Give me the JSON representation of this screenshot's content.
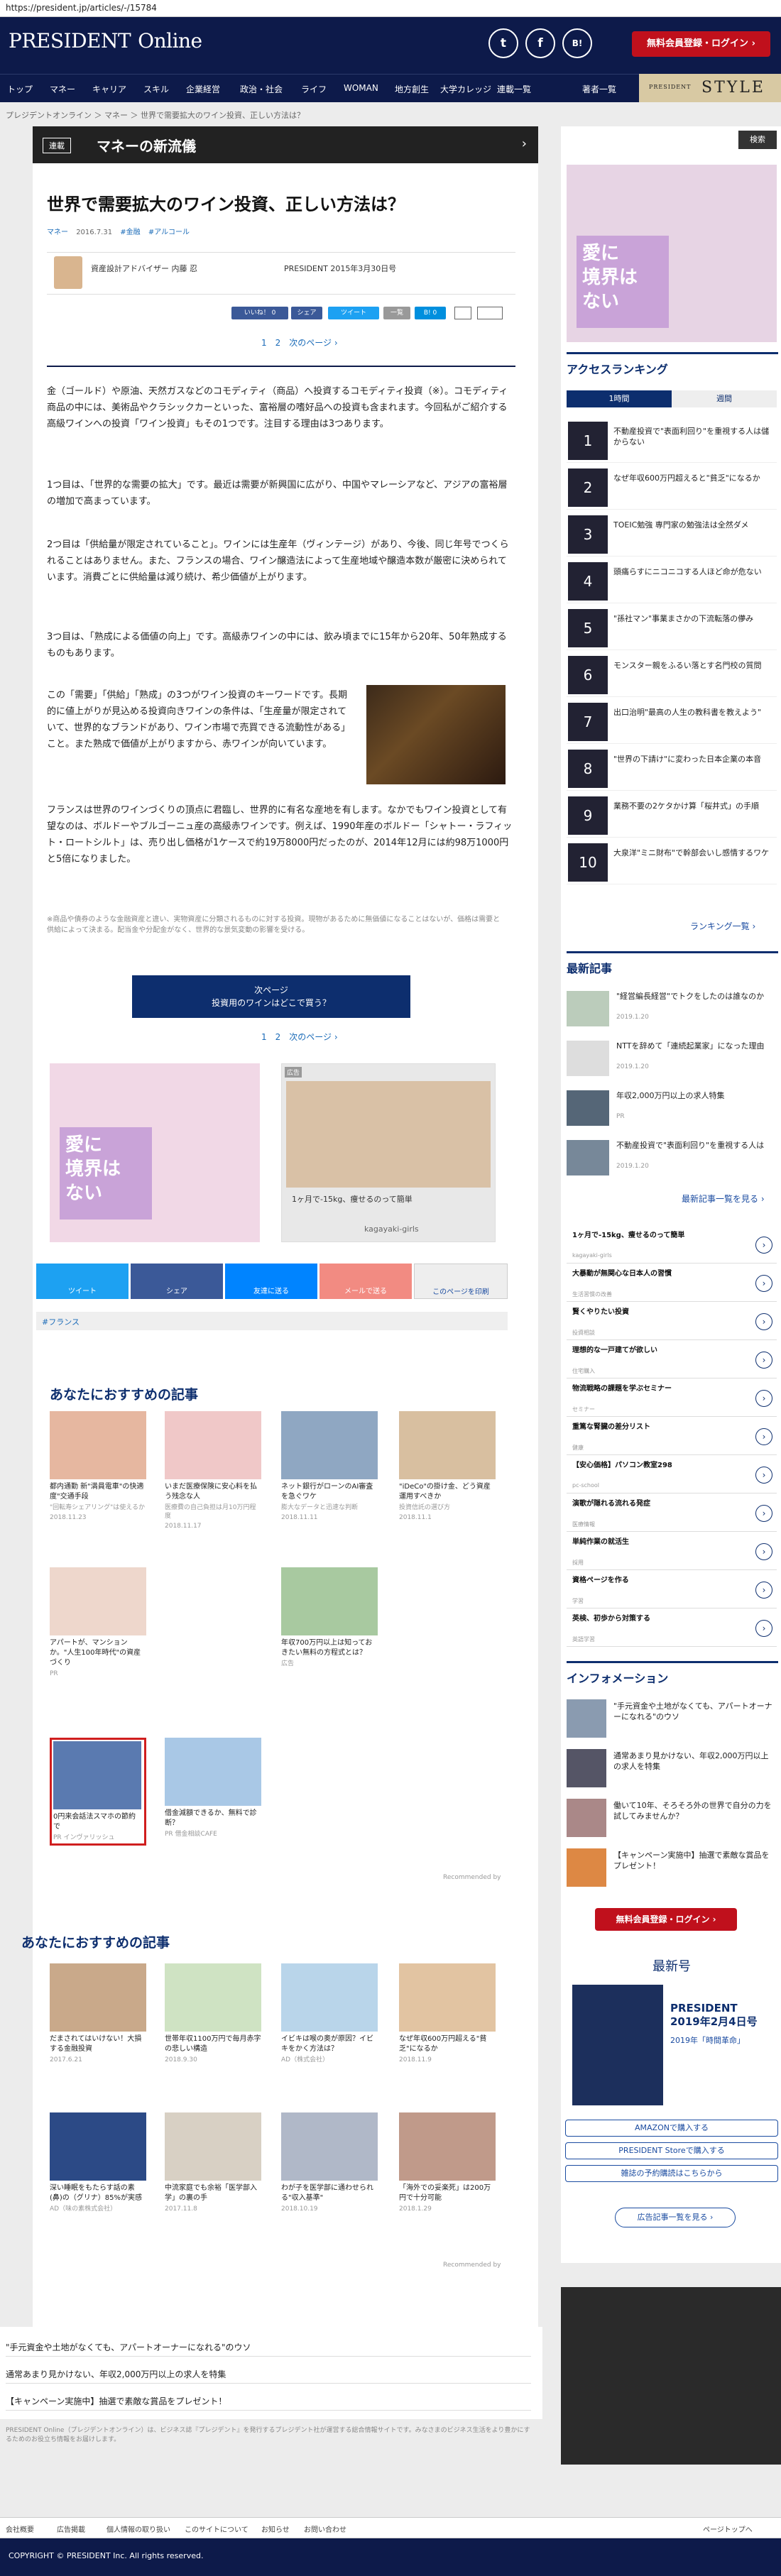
{
  "browser": {
    "url": "https://president.jp/articles/-/15784"
  },
  "header": {
    "logo_a": "PRESIDENT",
    "logo_b": "Online",
    "social": [
      "t",
      "f",
      "B!"
    ],
    "register": "無料会員登録・ログイン ›"
  },
  "nav": {
    "items": [
      "トップ",
      "マネー",
      "キャリア",
      "スキル",
      "企業経営",
      "政治・社会",
      "ライフ",
      "WOMAN",
      "地方創生",
      "大学カレッジ",
      "連載一覧",
      "著者一覧"
    ],
    "style_small": "PRESIDENT",
    "style": "STYLE"
  },
  "breadcrumb": "プレジデントオンライン ＞ マネー ＞ 世界で需要拡大のワイン投資、正しい方法は？",
  "band": {
    "tag": "連載",
    "title": "マネーの新流儀"
  },
  "article": {
    "title": "世界で需要拡大のワイン投資、正しい方法は？",
    "meta": [
      "マネー",
      "2016.7.31",
      "#金融",
      "#アルコール"
    ],
    "author": "資産設計アドバイザー 内藤 忍",
    "date": "PRESIDENT 2015年3月30日号",
    "share": [
      "いいね！ 0",
      "シェア",
      "ツイート",
      "一覧",
      "B! 0"
    ],
    "pager": "1　2　次のページ ›",
    "p1": "金（ゴールド）や原油、天然ガスなどのコモディティ（商品）へ投資するコモディティ投資（※）。コモディティ商品の中には、美術品やクラシックカーといった、富裕層の嗜好品への投資も含まれます。今回私がご紹介する高級ワインへの投資「ワイン投資」もその1つです。注目する理由は3つあります。",
    "p2": "1つ目は、「世界的な需要の拡大」です。最近は需要が新興国に広がり、中国やマレーシアなど、アジアの富裕層の増加で高まっています。",
    "p3": "2つ目は「供給量が限定されていること」。ワインには生産年（ヴィンテージ）があり、今後、同じ年号でつくられることはありません。また、フランスの場合、ワイン醸造法によって生産地域や醸造本数が厳密に決められています。消費ごとに供給量は減り続け、希少価値が上がります。",
    "p4": "3つ目は、「熟成による価値の向上」です。高級赤ワインの中には、飲み頃までに15年から20年、50年熟成するものもあります。",
    "p5": "この「需要」「供給」「熟成」の3つがワイン投資のキーワードです。長期的に値上がりが見込める投資向きワインの条件は、「生産量が限定されていて、世界的なブランドがあり、ワイン市場で売買できる流動性がある」こと。また熟成で価値が上がりますから、赤ワインが向いています。",
    "p6": "フランスは世界のワインづくりの頂点に君臨し、世界的に有名な産地を有します。なかでもワイン投資として有望なのは、ボルドーやブルゴーニュ産の高級赤ワインです。例えば、1990年産のボルドー「シャトー・ラフィット・ロートシルト」は、売り出し価格が1ケースで約19万8000円だったのが、2014年12月には約98万1000円と5倍になりました。",
    "note": "※商品や債券のような金融資産と違い、実物資産に分類されるものに対する投資。現物があるために無価値になることはないが、価格は需要と供給によって決まる。配当金や分配金がなく、世界的な景気変動の影響を受ける。",
    "next_l1": "次ページ",
    "next_l2": "投資用のワインはどこで買う？",
    "pager2": "1　2　次のページ ›"
  },
  "ads": {
    "left": "愛に\n境界は\nない",
    "right_label": "広告",
    "right_text": "1ヶ月で-15kg、痩せるのって簡単",
    "right_url": "kagayaki-girls"
  },
  "sharebar": [
    "ツイート",
    "シェア",
    "友達に送る",
    "メールで送る",
    "このページを印刷"
  ],
  "tags": "#フランス",
  "rec1": {
    "title": "あなたにおすすめの記事",
    "cards": [
      {
        "t": "都内通勤 新\"満員電車\"の快適度\"交通手段",
        "s": "\"回転寿シェアリング\"は使えるか",
        "d": "2018.11.23"
      },
      {
        "t": "いまだ医療保険に安心料を払う残念な人",
        "s": "医療費の自己負担は月10万円程度",
        "d": "2018.11.17"
      },
      {
        "t": "ネット銀行がローンのAI審査を急ぐワケ",
        "s": "膨大なデータと迅速な判断",
        "d": "2018.11.11"
      },
      {
        "t": "\"iDeCo\"の掛け金、どう資産運用すべきか",
        "s": "投資信託の選び方",
        "d": "2018.11.1"
      },
      {
        "t": "アパートが、マンションか。\"人生100年時代\"の資産づくり",
        "s": "",
        "d": "PR"
      },
      {
        "t": "年収700万円以上は知っておきたい無料の方程式とは？",
        "s": "",
        "d": "広告"
      },
      {
        "t": "0円来会話法スマホの節約で",
        "s": "PR インヴァリッシュ",
        "d": ""
      },
      {
        "t": "借金減額できるか、無料で診断？",
        "s": "PR 借金相談CAFE",
        "d": ""
      }
    ],
    "recby": "Recommended by"
  },
  "rec2": {
    "title": "あなたにおすすめの記事",
    "cards": [
      {
        "t": "だまされてはいけない！大損する金融投資",
        "s": "高利回りの外国債券",
        "d": "2017.6.21"
      },
      {
        "t": "世帯年収1100万円で毎月赤字の悲しい構造",
        "s": "教育費と住宅ローン",
        "d": "2018.9.30"
      },
      {
        "t": "イビキは喉の奥が原因？イビキをかく方法は？",
        "s": "AD（株式会社）",
        "d": ""
      },
      {
        "t": "なぜ年収600万円超える\"貧乏\"になるか",
        "s": "年収と支出",
        "d": "2018.11.9"
      },
      {
        "t": "深い睡眠をもたらす話の素(鼻)の（グリナ）85%が実感",
        "s": "AD（味の素株式会社）",
        "d": ""
      },
      {
        "t": "中流家庭でも余裕「医学部入学」の裏の手",
        "s": "リクルートの医学部",
        "d": "2017.11.8"
      },
      {
        "t": "わが子を医学部に通わせられる\"収入基準\"",
        "s": "受験費用と学費",
        "d": "2018.10.19"
      },
      {
        "t": "「海外での妥楽死」は200万円で十分可能",
        "s": "安楽死の実態",
        "d": "2018.1.29"
      }
    ],
    "recby": "Recommended by"
  },
  "side": {
    "search": "検索",
    "ad_text": "愛に\n境界は\nない",
    "rank_title": "アクセスランキング",
    "rank_tabs": [
      "1時間",
      "週間"
    ],
    "ranks": [
      {
        "n": "1",
        "t": "不動産投資で\"表面利回り\"を重視する人は儲からない"
      },
      {
        "n": "2",
        "t": "なぜ年収600万円超えると\"貧乏\"になるか"
      },
      {
        "n": "3",
        "t": "TOEIC勉強 専門家の勉強法は全然ダメ"
      },
      {
        "n": "4",
        "t": "頭痛らすにニコニコする人ほど命が危ない"
      },
      {
        "n": "5",
        "t": "\"孫社マン\"事業まさかの下流転落の儚み"
      },
      {
        "n": "6",
        "t": "モンスター親をふるい落とす名門校の質問"
      },
      {
        "n": "7",
        "t": "出口治明\"最高の人生の教科書を教えよう\""
      },
      {
        "n": "8",
        "t": "\"世界の下請け\"に変わった日本企業の本音"
      },
      {
        "n": "9",
        "t": "業務不要の2ケタかけ算「桜井式」の手順"
      },
      {
        "n": "10",
        "t": "大泉洋\"ミニ財布\"で幹部会いし感情するワケ"
      }
    ],
    "rank_more": "ランキング一覧 ›",
    "latest_title": "最新記事",
    "latest": [
      {
        "t": "\"経営編長経営\"でトクをしたのは誰なのか",
        "d": "2019.1.20"
      },
      {
        "t": "NTTを辞めて「連続起業家」になった理由",
        "d": "2019.1.20"
      },
      {
        "t": "年収2,000万円以上の求人特集",
        "d": "PR"
      },
      {
        "t": "不動産投資で\"表面利回り\"を重視する人は",
        "d": "2019.1.20"
      }
    ],
    "latest_more": "最新記事一覧を見る ›",
    "adlist": [
      {
        "t": "1ヶ月で-15kg、痩せるのって簡単",
        "u": "kagayaki-girls"
      },
      {
        "t": "大暴動が無関心な日本人の習慣",
        "u": "生活習慣の改善"
      },
      {
        "t": "賢くやりたい投資",
        "u": "投資相談"
      },
      {
        "t": "理想的な一戸建てが欲しい",
        "u": "住宅購入"
      },
      {
        "t": "物流戦略の課題を学ぶセミナー",
        "u": "セミナー"
      },
      {
        "t": "重篤な腎臓の差分リスト",
        "u": "健康"
      },
      {
        "t": "【安心価格】パソコン教室298",
        "u": "pc-school"
      },
      {
        "t": "演歌が隠れる流れる発症",
        "u": "医療情報"
      },
      {
        "t": "単純作業の就活生",
        "u": "採用"
      },
      {
        "t": "資格ページを作る",
        "u": "学習"
      },
      {
        "t": "英検、初歩から対策する",
        "u": "英語学習"
      }
    ],
    "info_title": "インフォメーション",
    "info": [
      {
        "t": "\"手元資金や土地がなくても、アパートオーナーになれる\"のウソ"
      },
      {
        "t": "通常あまり見かけない、年収2,000万円以上の求人を特集"
      },
      {
        "t": "働いて10年、そろそろ外の世界で自分の力を試してみませんか？"
      },
      {
        "t": "【キャンペーン実施中】抽選で素敵な賞品をプレゼント！"
      }
    ],
    "register": "無料会員登録・ログイン ›",
    "latest_issue": "最新号",
    "mag_title": "PRESIDENT\n2019年2月4日号",
    "mag_sub": "2019年「時間革命」",
    "buy": [
      "AMAZONで購入する",
      "PRESIDENT Storeで購入する",
      "雑誌の予約購読はこちらから"
    ],
    "ad_more": "広告記事一覧を見る ›"
  },
  "footer": {
    "lines": [
      "\"手元資金や土地がなくても、アパートオーナーになれる\"のウソ",
      "通常あまり見かけない、年収2,000万円以上の求人を特集",
      "【キャンペーン実施中】抽選で素敵な賞品をプレゼント！"
    ],
    "desc": "PRESIDENT Online（プレジデントオンライン）は、ビジネス誌『プレジデント』を発行するプレジデント社が運営する総合情報サイトです。みなさまのビジネス生活をより豊かにするためのお役立ち情報をお届けします。",
    "links": [
      "会社概要",
      "広告掲載",
      "個人情報の取り扱い",
      "このサイトについて",
      "お知らせ",
      "お問い合わせ"
    ],
    "pagetop": "ページトップへ",
    "copy": "COPYRIGHT © PRESIDENT Inc. All rights reserved."
  }
}
